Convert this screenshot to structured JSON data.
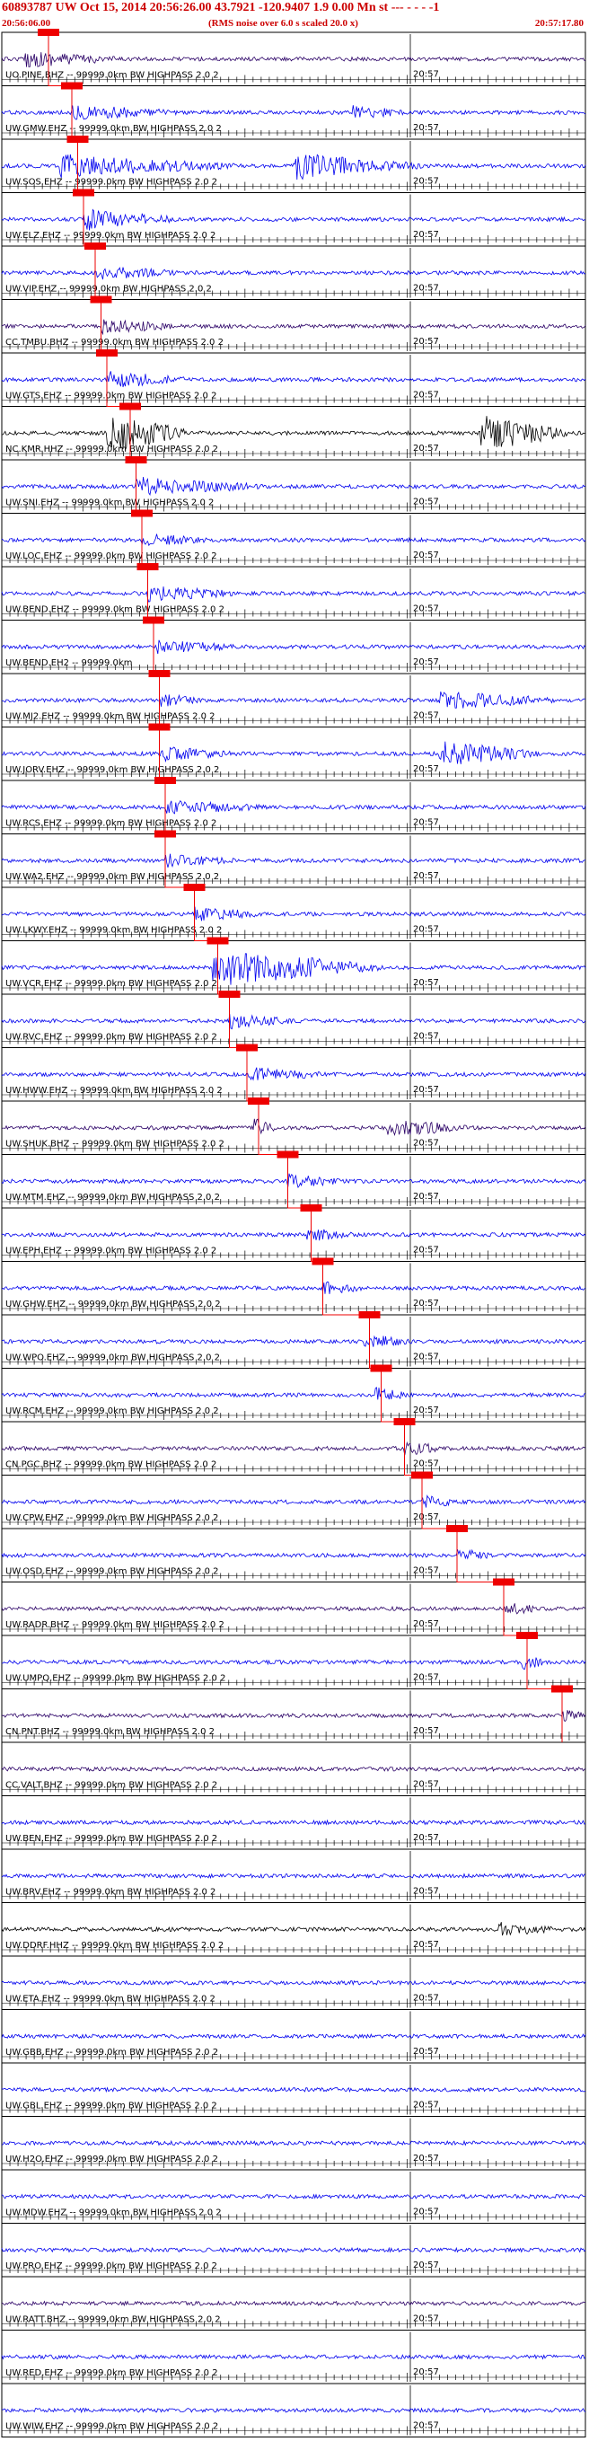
{
  "header": {
    "title": "60893787 UW Oct 15, 2014 20:56:26.00   43.7921 -120.9407  1.9 0.00 Mn st --- - - -  -1",
    "start_time": "20:56:06.00",
    "note": "(RMS noise over 6.0 s scaled 20.0 x)",
    "end_time": "20:57:17.80"
  },
  "colors": {
    "trace_blue": "#0000ee",
    "trace_purple": "#2a0066",
    "trace_black": "#000000",
    "pick_red": "#ee0000",
    "grid": "#000000"
  },
  "chart_data": {
    "type": "line",
    "title": "60893787 UW Oct 15, 2014 20:56:26.00   43.7921 -120.9407  1.9 0.00 Mn st --- - - -  -1",
    "x_range": [
      "20:56:06.00",
      "20:57:17.80"
    ],
    "minute_mark_label": "20:57",
    "channels": [
      {
        "label": "UO.PINE.BHZ -- 99999.0km BW  HIGHPASS  2.0  2",
        "color": "purple",
        "pick": 0.08,
        "bursts": [
          [
            0.04,
            0.2,
            1.8
          ]
        ]
      },
      {
        "label": "UW.GMW.EHZ -- 99999.0km BW  HIGHPASS  2.0  2",
        "color": "blue",
        "pick": 0.12,
        "bursts": [
          [
            0.12,
            0.3,
            1.6
          ],
          [
            0.6,
            0.7,
            1.3
          ]
        ]
      },
      {
        "label": "UW.SOS.EHZ -- 99999.0km BW  HIGHPASS  2.0  2",
        "color": "blue",
        "pick": 0.13,
        "bursts": [
          [
            0.1,
            0.4,
            2.5
          ],
          [
            0.5,
            0.72,
            3.0
          ]
        ]
      },
      {
        "label": "UW.ELZ.EHZ -- 99999.0km BW  HIGHPASS  2.0  2",
        "color": "blue",
        "pick": 0.14,
        "bursts": [
          [
            0.14,
            0.3,
            2.4
          ]
        ]
      },
      {
        "label": "UW.VIP.EHZ -- 99999.0km BW  HIGHPASS  2.0  2",
        "color": "blue",
        "pick": 0.16,
        "bursts": [
          [
            0.16,
            0.3,
            1.6
          ]
        ]
      },
      {
        "label": "CC.TMBU.BHZ -- 99999.0km BW  HIGHPASS  2.0  2",
        "color": "purple",
        "pick": 0.17,
        "bursts": [
          [
            0.17,
            0.3,
            1.5
          ]
        ]
      },
      {
        "label": "UW.GTS.EHZ -- 99999.0km BW  HIGHPASS  2.0  2",
        "color": "blue",
        "pick": 0.18,
        "bursts": [
          [
            0.18,
            0.32,
            1.8
          ]
        ]
      },
      {
        "label": "NC.KMR.HHZ -- 99999.0km BW  HIGHPASS  2.0  2",
        "color": "black",
        "pick": 0.22,
        "bursts": [
          [
            0.18,
            0.32,
            5.0
          ],
          [
            0.82,
            0.97,
            4.5
          ]
        ]
      },
      {
        "label": "UW.SNI.EHZ -- 99999.0km BW  HIGHPASS  2.0  2",
        "color": "blue",
        "pick": 0.23,
        "bursts": [
          [
            0.23,
            0.45,
            2.0
          ]
        ]
      },
      {
        "label": "UW.LOC.EHZ -- 99999.0km BW  HIGHPASS  2.0  2",
        "color": "blue",
        "pick": 0.24,
        "bursts": [
          [
            0.24,
            0.35,
            1.4
          ]
        ]
      },
      {
        "label": "UW.BEND.EHZ -- 99999.0km BW  HIGHPASS  2.0  2",
        "color": "blue",
        "pick": 0.25,
        "bursts": [
          [
            0.25,
            0.4,
            1.8
          ]
        ]
      },
      {
        "label": "UW.BEND.EH2 -- 99999.0km",
        "color": "blue",
        "pick": 0.26,
        "bursts": [
          [
            0.26,
            0.4,
            1.5
          ]
        ]
      },
      {
        "label": "UW.MJ2.EHZ -- 99999.0km BW  HIGHPASS  2.0  2",
        "color": "blue",
        "pick": 0.27,
        "bursts": [
          [
            0.27,
            0.35,
            1.3
          ],
          [
            0.75,
            0.95,
            2.0
          ]
        ]
      },
      {
        "label": "UW.JORV.EHZ -- 99999.0km BW  HIGHPASS  2.0  2",
        "color": "blue",
        "pick": 0.27,
        "bursts": [
          [
            0.27,
            0.4,
            1.5
          ],
          [
            0.75,
            0.92,
            3.0
          ]
        ]
      },
      {
        "label": "UW.RCS.EHZ -- 99999.0km BW  HIGHPASS  2.0  2",
        "color": "blue",
        "pick": 0.28,
        "bursts": [
          [
            0.28,
            0.45,
            1.5
          ]
        ]
      },
      {
        "label": "UW.WA2.EHZ -- 99999.0km BW  HIGHPASS  2.0  2",
        "color": "blue",
        "pick": 0.28,
        "bursts": [
          [
            0.28,
            0.4,
            1.3
          ]
        ]
      },
      {
        "label": "UW.LKWY.EHZ -- 99999.0km BW  HIGHPASS  2.0  2",
        "color": "blue",
        "pick": 0.33,
        "bursts": [
          [
            0.33,
            0.45,
            1.4
          ]
        ]
      },
      {
        "label": "UW.VCR.EHZ -- 99999.0km BW  HIGHPASS  2.0  2",
        "color": "blue",
        "pick": 0.37,
        "bursts": [
          [
            0.36,
            0.65,
            4.5
          ]
        ]
      },
      {
        "label": "UW.RVC.EHZ -- 99999.0km BW  HIGHPASS  2.0  2",
        "color": "blue",
        "pick": 0.39,
        "bursts": [
          [
            0.39,
            0.5,
            1.5
          ]
        ]
      },
      {
        "label": "UW.HWW.EHZ -- 99999.0km BW  HIGHPASS  2.0  2",
        "color": "blue",
        "pick": 0.42,
        "bursts": [
          [
            0.42,
            0.55,
            1.6
          ]
        ]
      },
      {
        "label": "UW.SHUK.BHZ -- 99999.0km BW  HIGHPASS  2.0  2",
        "color": "purple",
        "pick": 0.44,
        "bursts": [
          [
            0.43,
            0.47,
            2.5
          ],
          [
            0.66,
            0.8,
            2.0
          ]
        ]
      },
      {
        "label": "UW.MTM.EHZ -- 99999.0km BW  HIGHPASS  2.0  2",
        "color": "blue",
        "pick": 0.49,
        "bursts": [
          [
            0.49,
            0.58,
            1.6
          ]
        ]
      },
      {
        "label": "UW.EPH.EHZ -- 99999.0km BW  HIGHPASS  2.0  2",
        "color": "blue",
        "pick": 0.53,
        "bursts": [
          [
            0.52,
            0.6,
            1.5
          ]
        ]
      },
      {
        "label": "UW.GHW.EHZ -- 99999.0km BW  HIGHPASS  2.0  2",
        "color": "blue",
        "pick": 0.55,
        "bursts": [
          [
            0.55,
            0.62,
            1.3
          ]
        ]
      },
      {
        "label": "UW.WPO.EHZ -- 99999.0km BW  HIGHPASS  2.0  2",
        "color": "blue",
        "pick": 0.63,
        "bursts": [
          [
            0.62,
            0.7,
            1.6
          ]
        ]
      },
      {
        "label": "UW.RCM.EHZ -- 99999.0km BW  HIGHPASS  2.0  2",
        "color": "blue",
        "pick": 0.65,
        "bursts": [
          [
            0.64,
            0.7,
            1.5
          ]
        ]
      },
      {
        "label": "CN.PGC.BHZ -- 99999.0km BW  HIGHPASS  2.0  2",
        "color": "purple",
        "pick": 0.69,
        "bursts": [
          [
            0.69,
            0.75,
            1.8
          ]
        ]
      },
      {
        "label": "UW.CPW.EHZ -- 99999.0km BW  HIGHPASS  2.0  2",
        "color": "blue",
        "pick": 0.72,
        "bursts": [
          [
            0.72,
            0.78,
            1.5
          ]
        ]
      },
      {
        "label": "UW.OSD.EHZ -- 99999.0km BW  HIGHPASS  2.0  2",
        "color": "blue",
        "pick": 0.78,
        "bursts": [
          [
            0.78,
            0.84,
            1.4
          ]
        ]
      },
      {
        "label": "UW.RADR.BHZ -- 99999.0km BW  HIGHPASS  2.0  2",
        "color": "purple",
        "pick": 0.86,
        "bursts": [
          [
            0.86,
            0.92,
            1.4
          ]
        ]
      },
      {
        "label": "UW.UMPQ.EHZ -- 99999.0km BW  HIGHPASS  2.0  2",
        "color": "blue",
        "pick": 0.9,
        "bursts": [
          [
            0.89,
            0.93,
            2.0
          ]
        ]
      },
      {
        "label": "CN.PNT.BHZ -- 99999.0km BW  HIGHPASS  2.0  2",
        "color": "purple",
        "pick": 0.96,
        "bursts": [
          [
            0.96,
            1.0,
            1.4
          ]
        ]
      },
      {
        "label": "CC.VALT.BHZ -- 99999.0km BW  HIGHPASS  2.0  2",
        "color": "purple",
        "pick": null,
        "bursts": []
      },
      {
        "label": "UW.BEN.EHZ -- 99999.0km BW  HIGHPASS  2.0  2",
        "color": "blue",
        "pick": null,
        "bursts": []
      },
      {
        "label": "UW.BRV.EHZ -- 99999.0km BW  HIGHPASS  2.0  2",
        "color": "blue",
        "pick": null,
        "bursts": []
      },
      {
        "label": "UW.DDRF.HHZ -- 99999.0km BW  HIGHPASS  2.0  2",
        "color": "black",
        "pick": null,
        "bursts": [
          [
            0.85,
            0.95,
            1.4
          ]
        ]
      },
      {
        "label": "UW.ETA.EHZ -- 99999.0km BW  HIGHPASS  2.0  2",
        "color": "blue",
        "pick": null,
        "bursts": []
      },
      {
        "label": "UW.GBB.EHZ -- 99999.0km BW  HIGHPASS  2.0  2",
        "color": "blue",
        "pick": null,
        "bursts": []
      },
      {
        "label": "UW.GBL.EHZ -- 99999.0km BW  HIGHPASS  2.0  2",
        "color": "blue",
        "pick": null,
        "bursts": []
      },
      {
        "label": "UW.H2O.EHZ -- 99999.0km BW  HIGHPASS  2.0  2",
        "color": "blue",
        "pick": null,
        "bursts": []
      },
      {
        "label": "UW.MDW.EHZ -- 99999.0km BW  HIGHPASS  2.0  2",
        "color": "blue",
        "pick": null,
        "bursts": []
      },
      {
        "label": "UW.PRO.EHZ -- 99999.0km BW  HIGHPASS  2.0  2",
        "color": "blue",
        "pick": null,
        "bursts": []
      },
      {
        "label": "UW.RATT.BHZ -- 99999.0km BW  HIGHPASS  2.0  2",
        "color": "purple",
        "pick": null,
        "bursts": []
      },
      {
        "label": "UW.RED.EHZ -- 99999.0km BW  HIGHPASS  2.0  2",
        "color": "blue",
        "pick": null,
        "bursts": []
      },
      {
        "label": "UW.WIW.EHZ -- 99999.0km BW  HIGHPASS  2.0  2",
        "color": "blue",
        "pick": null,
        "bursts": []
      }
    ]
  }
}
